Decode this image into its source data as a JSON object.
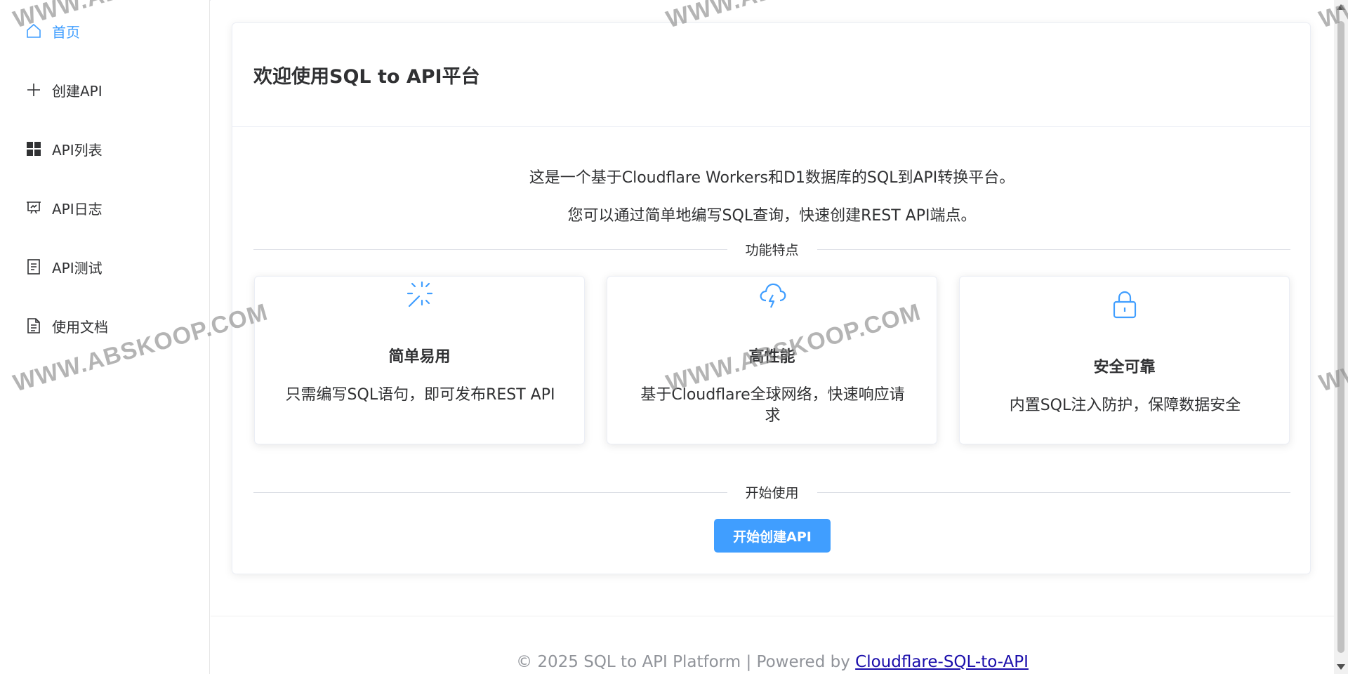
{
  "sidebar": {
    "items": [
      {
        "label": "首页",
        "icon": "home-icon",
        "active": true
      },
      {
        "label": "创建API",
        "icon": "plus-icon",
        "active": false
      },
      {
        "label": "API列表",
        "icon": "grid-icon",
        "active": false
      },
      {
        "label": "API日志",
        "icon": "presentation-icon",
        "active": false
      },
      {
        "label": "API测试",
        "icon": "document-list-icon",
        "active": false
      },
      {
        "label": "使用文档",
        "icon": "document-icon",
        "active": false
      }
    ]
  },
  "main": {
    "title": "欢迎使用SQL to API平台",
    "intro": [
      "这是一个基于Cloudflare Workers和D1数据库的SQL到API转换平台。",
      "您可以通过简单地编写SQL查询，快速创建REST API端点。"
    ],
    "features_divider": "功能特点",
    "features": [
      {
        "icon": "magic-wand-icon",
        "title": "简单易用",
        "desc": "只需编写SQL语句，即可发布REST API"
      },
      {
        "icon": "cloud-lightning-icon",
        "title": "高性能",
        "desc": "基于Cloudflare全球网络，快速响应请求"
      },
      {
        "icon": "lock-icon",
        "title": "安全可靠",
        "desc": "内置SQL注入防护，保障数据安全"
      }
    ],
    "start_divider": "开始使用",
    "start_button": "开始创建API"
  },
  "footer": {
    "text": "© 2025 SQL to API Platform | Powered by ",
    "link": "Cloudflare-SQL-to-API"
  },
  "watermark": "WWW.ABSKOOP.COM",
  "colors": {
    "accent": "#409eff",
    "text": "#303133",
    "footer_text": "#909399"
  }
}
